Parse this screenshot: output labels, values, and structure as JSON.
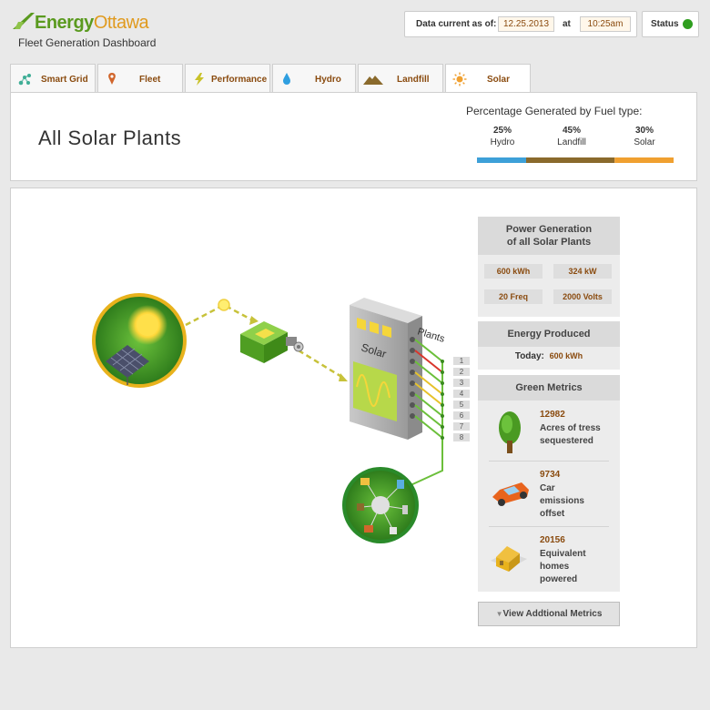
{
  "brand": {
    "name_part1": "Energy",
    "name_part2": "Ottawa",
    "subtitle": "Fleet Generation Dashboard"
  },
  "data_current": {
    "label": "Data current as of:",
    "date": "12.25.2013",
    "at": "at",
    "time": "10:25am"
  },
  "status": {
    "label": "Status",
    "color": "#2f9e1f"
  },
  "tabs": [
    {
      "label": "Smart Grid",
      "icon": "network-icon"
    },
    {
      "label": "Fleet",
      "icon": "map-pin-icon"
    },
    {
      "label": "Performance",
      "icon": "lightning-icon"
    },
    {
      "label": "Hydro",
      "icon": "water-drop-icon"
    },
    {
      "label": "Landfill",
      "icon": "mound-icon"
    },
    {
      "label": "Solar",
      "icon": "sun-icon",
      "active": true
    }
  ],
  "title_panel": {
    "title": "All Solar Plants",
    "fuel_title": "Percentage Generated by Fuel type:",
    "fuel": [
      {
        "value": "25%",
        "name": "Hydro",
        "fraction": 0.25,
        "color": "#3da0d8"
      },
      {
        "value": "45%",
        "name": "Landfill",
        "fraction": 0.45,
        "color": "#8a6a2c"
      },
      {
        "value": "30%",
        "name": "Solar",
        "fraction": 0.3,
        "color": "#f0a030"
      }
    ]
  },
  "diagram": {
    "panel_label": "Solar",
    "plants_label": "Plants",
    "plant_numbers": [
      "1",
      "2",
      "3",
      "4",
      "5",
      "6",
      "7",
      "8"
    ]
  },
  "power": {
    "title_line1": "Power Generation",
    "title_line2": "of all Solar Plants",
    "energy": "600 kWh",
    "power": "324 kW",
    "freq": "20 Freq",
    "volts": "2000 Volts"
  },
  "energy_produced": {
    "title": "Energy Produced",
    "label": "Today:",
    "value": "600 kWh"
  },
  "green_metrics": {
    "title": "Green Metrics",
    "items": [
      {
        "value": "12982",
        "line1": "Acres of tress",
        "line2": "sequestered",
        "line3": "",
        "icon": "tree-icon"
      },
      {
        "value": "9734",
        "line1": "Car",
        "line2": "emissions",
        "line3": "offset",
        "icon": "car-icon"
      },
      {
        "value": "20156",
        "line1": "Equivalent",
        "line2": "homes",
        "line3": "powered",
        "icon": "house-icon"
      }
    ]
  },
  "more_button": "View Addtional Metrics"
}
